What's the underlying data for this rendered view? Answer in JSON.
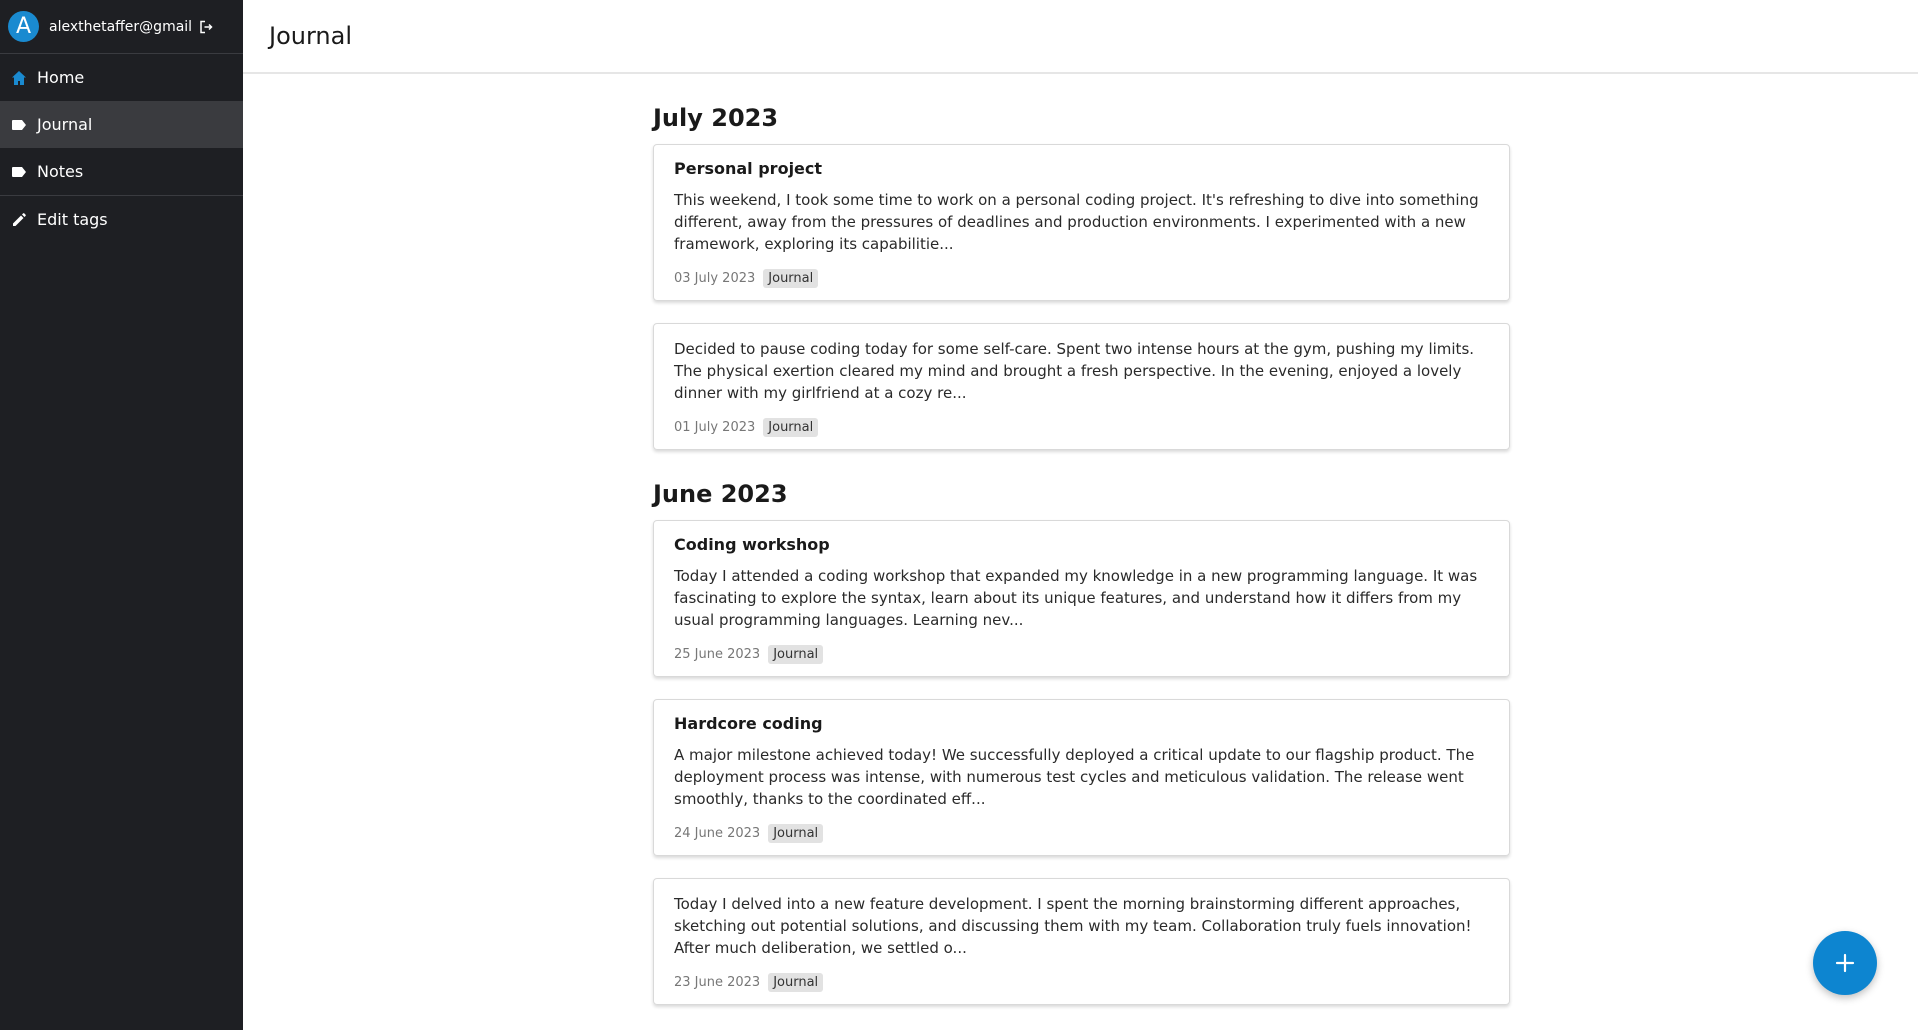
{
  "account": {
    "avatar_letter": "A",
    "email": "alexthetaffer@gmail.com"
  },
  "sidebar": {
    "items": [
      {
        "label": "Home",
        "icon": "home-icon"
      },
      {
        "label": "Journal",
        "icon": "tag-icon",
        "active": true
      },
      {
        "label": "Notes",
        "icon": "tag-icon"
      },
      {
        "label": "Edit tags",
        "icon": "pencil-icon"
      }
    ]
  },
  "header": {
    "title": "Journal"
  },
  "groups": [
    {
      "month": "July 2023",
      "entries": [
        {
          "title": "Personal project",
          "body": "This weekend, I took some time to work on a personal coding project. It's refreshing to dive into something different, away from the pressures of deadlines and production environments. I experimented with a new framework, exploring its capabilitie...",
          "date": "03 July 2023",
          "tag": "Journal"
        },
        {
          "title": "",
          "body": "Decided to pause coding today for some self-care. Spent two intense hours at the gym, pushing my limits. The physical exertion cleared my mind and brought a fresh perspective. In the evening, enjoyed a lovely dinner with my girlfriend at a cozy re...",
          "date": "01 July 2023",
          "tag": "Journal"
        }
      ]
    },
    {
      "month": "June 2023",
      "entries": [
        {
          "title": "Coding workshop",
          "body": "Today I attended a coding workshop that expanded my knowledge in a new programming language. It was fascinating to explore the syntax, learn about its unique features, and understand how it differs from my usual programming languages. Learning nev...",
          "date": "25 June 2023",
          "tag": "Journal"
        },
        {
          "title": "Hardcore coding",
          "body": "A major milestone achieved today! We successfully deployed a critical update to our flagship product. The deployment process was intense, with numerous test cycles and meticulous validation. The release went smoothly, thanks to the coordinated eff...",
          "date": "24 June 2023",
          "tag": "Journal"
        },
        {
          "title": "",
          "body": "Today I delved into a new feature development. I spent the morning brainstorming different approaches, sketching out potential solutions, and discussing them with my team. Collaboration truly fuels innovation! After much deliberation, we settled o...",
          "date": "23 June 2023",
          "tag": "Journal"
        }
      ]
    }
  ],
  "fab": {
    "icon": "plus-icon"
  },
  "colors": {
    "sidebar_bg": "#1e1f23",
    "accent": "#0d85d0",
    "active_item_bg": "#3a3b3f"
  }
}
